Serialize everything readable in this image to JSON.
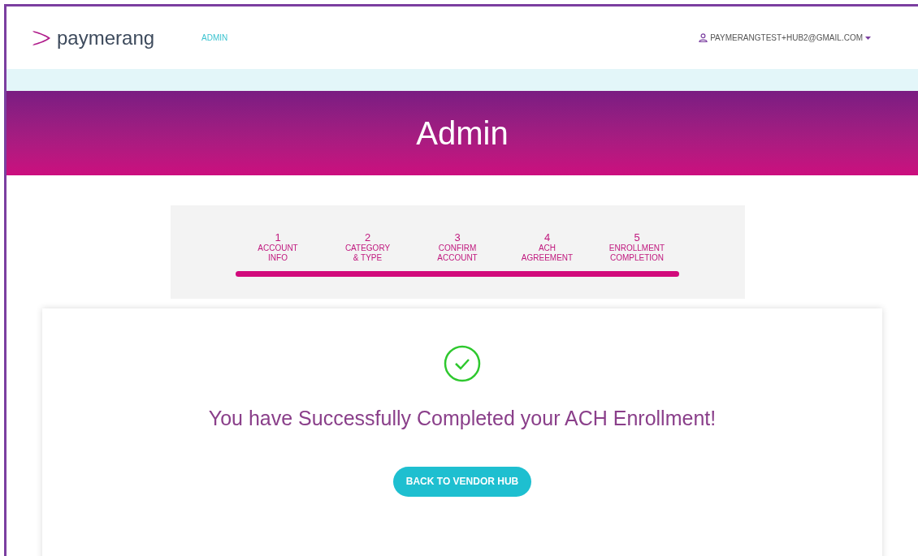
{
  "header": {
    "logo_text": "paymerang",
    "nav": [
      {
        "label": "ADMIN",
        "selected": true
      }
    ],
    "user_menu": "PAYMERANGTEST+HUB2@GMAIL.COM"
  },
  "banner": {
    "title": "Admin"
  },
  "stepper": {
    "steps": [
      {
        "number": "1",
        "label": "ACCOUNT",
        "sublabel": "INFO"
      },
      {
        "number": "2",
        "label": "CATEGORY",
        "sublabel": "& TYPE"
      },
      {
        "number": "3",
        "label": "CONFIRM",
        "sublabel": "ACCOUNT"
      },
      {
        "number": "4",
        "label": "ACH",
        "sublabel": "AGREEMENT"
      },
      {
        "number": "5",
        "label": "ENROLLMENT",
        "sublabel": "COMPLETION"
      }
    ],
    "level": 1
  },
  "result": {
    "message": "You have Successfully Completed your ACH Enrollment!",
    "button": "BACK TO VENDOR HUB"
  }
}
